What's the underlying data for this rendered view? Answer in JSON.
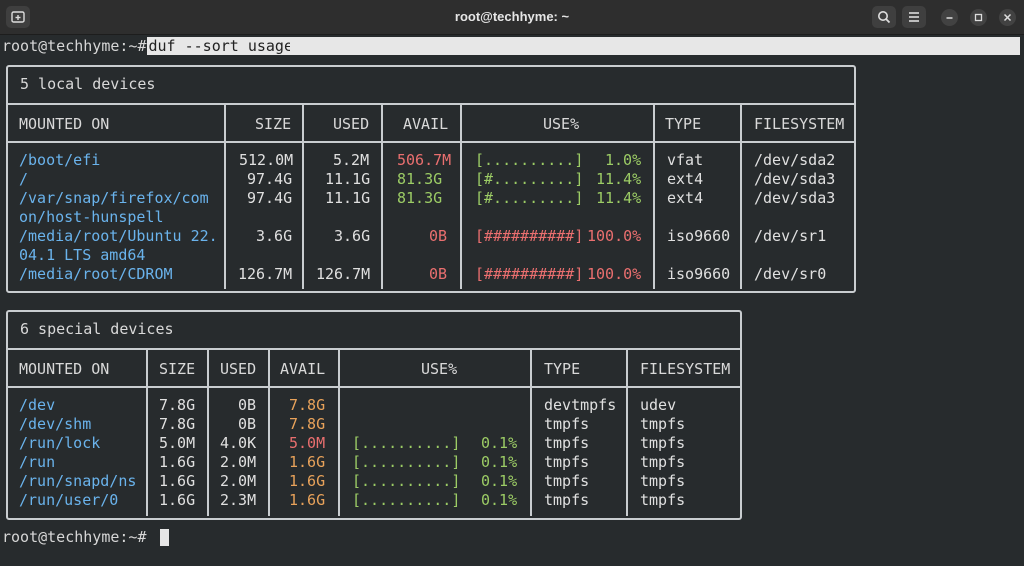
{
  "window": {
    "title": "root@techhyme: ~",
    "icons": [
      "new-tab-icon",
      "search-icon",
      "menu-icon",
      "minimize-icon",
      "maximize-icon",
      "close-icon"
    ]
  },
  "terminal": {
    "prompt": "root@techhyme:~#",
    "command": "duf --sort usage"
  },
  "local": {
    "title": "5 local devices",
    "headers": [
      "MOUNTED ON",
      "SIZE",
      "USED",
      "AVAIL",
      "USE%",
      "TYPE",
      "FILESYSTEM"
    ],
    "rows": [
      {
        "mount": "/boot/efi",
        "size": "512.0M",
        "used": "5.2M",
        "avail": "506.7M",
        "bar": "[..........]",
        "pct": "1.0%",
        "type": "vfat",
        "fs": "/dev/sda2"
      },
      {
        "mount": "/",
        "size": "97.4G",
        "used": "11.1G",
        "avail": "81.3G",
        "bar": "[#.........]",
        "pct": "11.4%",
        "type": "ext4",
        "fs": "/dev/sda3"
      },
      {
        "mount": "/var/snap/firefox/com",
        "mount2": "on/host-hunspell",
        "size": "97.4G",
        "used": "11.1G",
        "avail": "81.3G",
        "bar": "[#.........]",
        "pct": "11.4%",
        "type": "ext4",
        "fs": "/dev/sda3"
      },
      {
        "mount": "/media/root/Ubuntu 22.",
        "mount2": "04.1 LTS amd64",
        "size": "3.6G",
        "used": "3.6G",
        "avail": "0B",
        "bar": "[##########]",
        "pct": "100.0%",
        "type": "iso9660",
        "fs": "/dev/sr1"
      },
      {
        "mount": "/media/root/CDROM",
        "size": "126.7M",
        "used": "126.7M",
        "avail": "0B",
        "bar": "[##########]",
        "pct": "100.0%",
        "type": "iso9660",
        "fs": "/dev/sr0"
      }
    ]
  },
  "special": {
    "title": "6 special devices",
    "headers": [
      "MOUNTED ON",
      "SIZE",
      "USED",
      "AVAIL",
      "USE%",
      "TYPE",
      "FILESYSTEM"
    ],
    "rows": [
      {
        "mount": "/dev",
        "size": "7.8G",
        "used": "0B",
        "avail": "7.8G",
        "bar": "",
        "pct": "",
        "type": "devtmpfs",
        "fs": "udev"
      },
      {
        "mount": "/dev/shm",
        "size": "7.8G",
        "used": "0B",
        "avail": "7.8G",
        "bar": "",
        "pct": "",
        "type": "tmpfs",
        "fs": "tmpfs"
      },
      {
        "mount": "/run/lock",
        "size": "5.0M",
        "used": "4.0K",
        "avail": "5.0M",
        "bar": "[..........]",
        "pct": "0.1%",
        "type": "tmpfs",
        "fs": "tmpfs"
      },
      {
        "mount": "/run",
        "size": "1.6G",
        "used": "2.0M",
        "avail": "1.6G",
        "bar": "[..........]",
        "pct": "0.1%",
        "type": "tmpfs",
        "fs": "tmpfs"
      },
      {
        "mount": "/run/snapd/ns",
        "size": "1.6G",
        "used": "2.0M",
        "avail": "1.6G",
        "bar": "[..........]",
        "pct": "0.1%",
        "type": "tmpfs",
        "fs": "tmpfs"
      },
      {
        "mount": "/run/user/0",
        "size": "1.6G",
        "used": "2.3M",
        "avail": "1.6G",
        "bar": "[..........]",
        "pct": "0.1%",
        "type": "tmpfs",
        "fs": "tmpfs"
      }
    ]
  },
  "colors": {
    "path": "#6ab3ec",
    "ok": "#9ccc65",
    "full": "#ea6f6f",
    "warn": "#e8a25a"
  }
}
